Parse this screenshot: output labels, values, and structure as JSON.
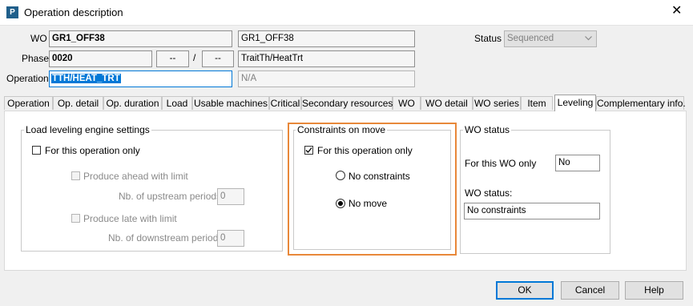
{
  "window": {
    "title": "Operation description",
    "app_icon_letter": "P",
    "close_glyph": "✕"
  },
  "header": {
    "wo_label": "WO",
    "wo_value": "GR1_OFF38",
    "wo_desc": "GR1_OFF38",
    "status_label": "Status",
    "status_value": "Sequenced",
    "phase_label": "Phase",
    "phase_value": "0020",
    "phase_a": "--",
    "phase_sep": "/",
    "phase_b": "--",
    "phase_desc": "TraitTh/HeatTrt",
    "operation_label": "Operation",
    "operation_value": "TTH/HEAT_TRT",
    "operation_desc": "N/A"
  },
  "tabs": [
    {
      "label": "Operation"
    },
    {
      "label": "Op. detail"
    },
    {
      "label": "Op. duration"
    },
    {
      "label": "Load"
    },
    {
      "label": "Usable machines"
    },
    {
      "label": "Critical"
    },
    {
      "label": "Secondary resources"
    },
    {
      "label": "WO"
    },
    {
      "label": "WO detail"
    },
    {
      "label": "WO series"
    },
    {
      "label": "Item"
    },
    {
      "label": "Leveling"
    },
    {
      "label": "Complementary info."
    }
  ],
  "active_tab": "Leveling",
  "load_leveling": {
    "title": "Load leveling engine settings",
    "for_this_op": "For this operation only",
    "for_this_op_checked": false,
    "produce_ahead": "Produce ahead with limit",
    "nb_upstream_label": "Nb. of upstream periods",
    "nb_upstream_value": "0",
    "produce_late": "Produce late with limit",
    "nb_downstream_label": "Nb. of downstream periods",
    "nb_downstream_value": "0"
  },
  "constraints": {
    "title": "Constraints on move",
    "for_this_op": "For this operation only",
    "for_this_op_checked": true,
    "no_constraints": "No constraints",
    "no_move": "No move",
    "selected": "No move",
    "highlight_color": "#e8883a"
  },
  "wo_status": {
    "title": "WO status",
    "for_this_wo_label": "For this WO only",
    "for_this_wo_value": "No",
    "status_label": "WO status:",
    "status_value": "No constraints"
  },
  "buttons": {
    "ok": "OK",
    "cancel": "Cancel",
    "help": "Help"
  },
  "colors": {
    "accent": "#0078d7",
    "selection": "#0078d7"
  }
}
